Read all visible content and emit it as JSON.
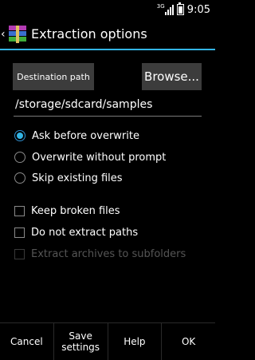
{
  "status": {
    "network": "3G",
    "time": "9:05"
  },
  "actionbar": {
    "title": "Extraction options",
    "up_icon": "chevron-left-icon",
    "app_icon": "winrar-books-icon"
  },
  "destination": {
    "button_label": "Destination path",
    "browse_label": "Browse...",
    "path": "/storage/sdcard/samples"
  },
  "overwrite_options": [
    {
      "label": "Ask before overwrite",
      "selected": true
    },
    {
      "label": "Overwrite without prompt",
      "selected": false
    },
    {
      "label": "Skip existing files",
      "selected": false
    }
  ],
  "checkboxes": [
    {
      "label": "Keep broken files",
      "checked": false,
      "enabled": true
    },
    {
      "label": "Do not extract paths",
      "checked": false,
      "enabled": true
    },
    {
      "label": "Extract archives to subfolders",
      "checked": false,
      "enabled": false
    }
  ],
  "bottom": {
    "cancel": "Cancel",
    "save_line1": "Save",
    "save_line2": "settings",
    "help": "Help",
    "ok": "OK"
  },
  "colors": {
    "accent": "#33b5e5",
    "button_bg": "#3c3c3c",
    "background": "#000000"
  }
}
